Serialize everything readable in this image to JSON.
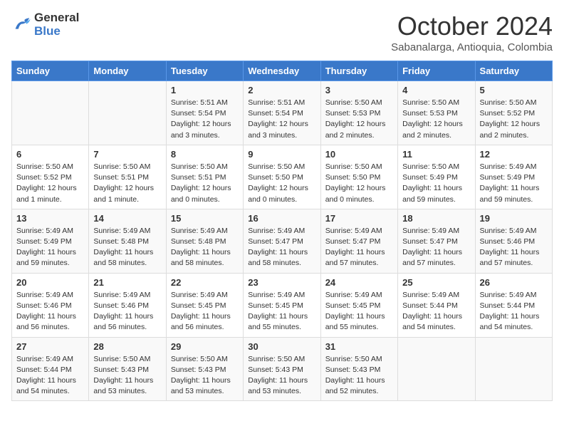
{
  "logo": {
    "line1": "General",
    "line2": "Blue"
  },
  "title": "October 2024",
  "subtitle": "Sabanalarga, Antioquia, Colombia",
  "days_of_week": [
    "Sunday",
    "Monday",
    "Tuesday",
    "Wednesday",
    "Thursday",
    "Friday",
    "Saturday"
  ],
  "weeks": [
    [
      {
        "day": "",
        "info": ""
      },
      {
        "day": "",
        "info": ""
      },
      {
        "day": "1",
        "info": "Sunrise: 5:51 AM\nSunset: 5:54 PM\nDaylight: 12 hours\nand 3 minutes."
      },
      {
        "day": "2",
        "info": "Sunrise: 5:51 AM\nSunset: 5:54 PM\nDaylight: 12 hours\nand 3 minutes."
      },
      {
        "day": "3",
        "info": "Sunrise: 5:50 AM\nSunset: 5:53 PM\nDaylight: 12 hours\nand 2 minutes."
      },
      {
        "day": "4",
        "info": "Sunrise: 5:50 AM\nSunset: 5:53 PM\nDaylight: 12 hours\nand 2 minutes."
      },
      {
        "day": "5",
        "info": "Sunrise: 5:50 AM\nSunset: 5:52 PM\nDaylight: 12 hours\nand 2 minutes."
      }
    ],
    [
      {
        "day": "6",
        "info": "Sunrise: 5:50 AM\nSunset: 5:52 PM\nDaylight: 12 hours\nand 1 minute."
      },
      {
        "day": "7",
        "info": "Sunrise: 5:50 AM\nSunset: 5:51 PM\nDaylight: 12 hours\nand 1 minute."
      },
      {
        "day": "8",
        "info": "Sunrise: 5:50 AM\nSunset: 5:51 PM\nDaylight: 12 hours\nand 0 minutes."
      },
      {
        "day": "9",
        "info": "Sunrise: 5:50 AM\nSunset: 5:50 PM\nDaylight: 12 hours\nand 0 minutes."
      },
      {
        "day": "10",
        "info": "Sunrise: 5:50 AM\nSunset: 5:50 PM\nDaylight: 12 hours\nand 0 minutes."
      },
      {
        "day": "11",
        "info": "Sunrise: 5:50 AM\nSunset: 5:49 PM\nDaylight: 11 hours\nand 59 minutes."
      },
      {
        "day": "12",
        "info": "Sunrise: 5:49 AM\nSunset: 5:49 PM\nDaylight: 11 hours\nand 59 minutes."
      }
    ],
    [
      {
        "day": "13",
        "info": "Sunrise: 5:49 AM\nSunset: 5:49 PM\nDaylight: 11 hours\nand 59 minutes."
      },
      {
        "day": "14",
        "info": "Sunrise: 5:49 AM\nSunset: 5:48 PM\nDaylight: 11 hours\nand 58 minutes."
      },
      {
        "day": "15",
        "info": "Sunrise: 5:49 AM\nSunset: 5:48 PM\nDaylight: 11 hours\nand 58 minutes."
      },
      {
        "day": "16",
        "info": "Sunrise: 5:49 AM\nSunset: 5:47 PM\nDaylight: 11 hours\nand 58 minutes."
      },
      {
        "day": "17",
        "info": "Sunrise: 5:49 AM\nSunset: 5:47 PM\nDaylight: 11 hours\nand 57 minutes."
      },
      {
        "day": "18",
        "info": "Sunrise: 5:49 AM\nSunset: 5:47 PM\nDaylight: 11 hours\nand 57 minutes."
      },
      {
        "day": "19",
        "info": "Sunrise: 5:49 AM\nSunset: 5:46 PM\nDaylight: 11 hours\nand 57 minutes."
      }
    ],
    [
      {
        "day": "20",
        "info": "Sunrise: 5:49 AM\nSunset: 5:46 PM\nDaylight: 11 hours\nand 56 minutes."
      },
      {
        "day": "21",
        "info": "Sunrise: 5:49 AM\nSunset: 5:46 PM\nDaylight: 11 hours\nand 56 minutes."
      },
      {
        "day": "22",
        "info": "Sunrise: 5:49 AM\nSunset: 5:45 PM\nDaylight: 11 hours\nand 56 minutes."
      },
      {
        "day": "23",
        "info": "Sunrise: 5:49 AM\nSunset: 5:45 PM\nDaylight: 11 hours\nand 55 minutes."
      },
      {
        "day": "24",
        "info": "Sunrise: 5:49 AM\nSunset: 5:45 PM\nDaylight: 11 hours\nand 55 minutes."
      },
      {
        "day": "25",
        "info": "Sunrise: 5:49 AM\nSunset: 5:44 PM\nDaylight: 11 hours\nand 54 minutes."
      },
      {
        "day": "26",
        "info": "Sunrise: 5:49 AM\nSunset: 5:44 PM\nDaylight: 11 hours\nand 54 minutes."
      }
    ],
    [
      {
        "day": "27",
        "info": "Sunrise: 5:49 AM\nSunset: 5:44 PM\nDaylight: 11 hours\nand 54 minutes."
      },
      {
        "day": "28",
        "info": "Sunrise: 5:50 AM\nSunset: 5:43 PM\nDaylight: 11 hours\nand 53 minutes."
      },
      {
        "day": "29",
        "info": "Sunrise: 5:50 AM\nSunset: 5:43 PM\nDaylight: 11 hours\nand 53 minutes."
      },
      {
        "day": "30",
        "info": "Sunrise: 5:50 AM\nSunset: 5:43 PM\nDaylight: 11 hours\nand 53 minutes."
      },
      {
        "day": "31",
        "info": "Sunrise: 5:50 AM\nSunset: 5:43 PM\nDaylight: 11 hours\nand 52 minutes."
      },
      {
        "day": "",
        "info": ""
      },
      {
        "day": "",
        "info": ""
      }
    ]
  ]
}
